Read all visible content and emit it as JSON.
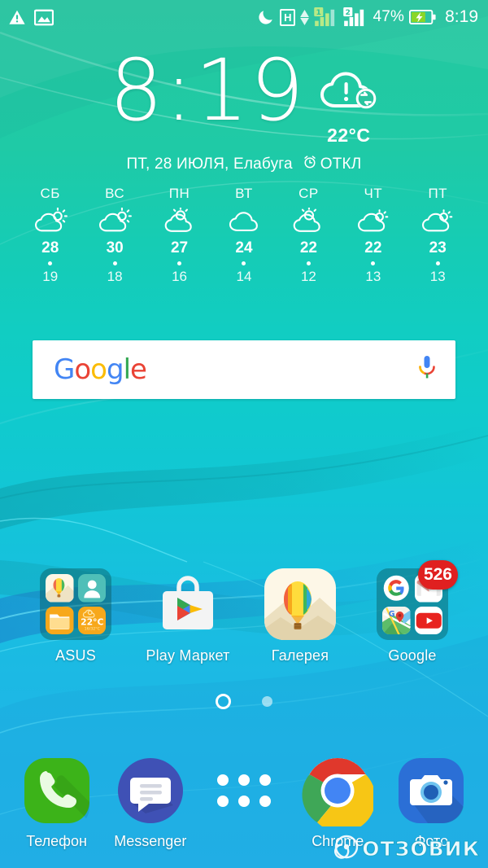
{
  "statusbar": {
    "left_icons": [
      {
        "name": "warning-icon",
        "glyph": "warning"
      },
      {
        "name": "photo-icon",
        "glyph": "image"
      }
    ],
    "dnd_icon": "moon-icon",
    "network_type": "H",
    "sim1_label": "1",
    "sim2_label": "2",
    "battery_percent": "47%",
    "battery_icon": "battery-charging-icon",
    "clock": "8:19"
  },
  "clock_widget": {
    "time": "8:19",
    "weather_icon": "cloud-alert-refresh-icon",
    "temperature": "22°C",
    "date_line": "ПТ, 28 ИЮЛЯ, Елабуга",
    "alarm_icon": "alarm-clock-icon",
    "alarm_status": "ОТКЛ"
  },
  "forecast": {
    "days": [
      {
        "day": "СБ",
        "icon": "partly-cloudy-icon",
        "high": "28",
        "low": "19"
      },
      {
        "day": "ВС",
        "icon": "partly-cloudy-icon",
        "high": "30",
        "low": "18"
      },
      {
        "day": "ПН",
        "icon": "sun-behind-cloud-icon",
        "high": "27",
        "low": "16"
      },
      {
        "day": "ВТ",
        "icon": "cloudy-icon",
        "high": "24",
        "low": "14"
      },
      {
        "day": "СР",
        "icon": "sun-behind-cloud-icon",
        "high": "22",
        "low": "12"
      },
      {
        "day": "ЧТ",
        "icon": "partly-cloudy-icon",
        "high": "22",
        "low": "13"
      },
      {
        "day": "ПТ",
        "icon": "partly-cloudy-icon",
        "high": "23",
        "low": "13"
      }
    ]
  },
  "search": {
    "logo_letters": [
      {
        "char": "G",
        "color": "#4285F4"
      },
      {
        "char": "o",
        "color": "#EA4335"
      },
      {
        "char": "o",
        "color": "#FBBC05"
      },
      {
        "char": "g",
        "color": "#4285F4"
      },
      {
        "char": "l",
        "color": "#34A853"
      },
      {
        "char": "e",
        "color": "#EA4335"
      }
    ],
    "mic_icon": "microphone-icon"
  },
  "apps": {
    "row1": [
      {
        "label": "ASUS",
        "type": "folder",
        "icon": "asus-folder-icon",
        "contents": [
          "gallery-balloon-icon",
          "contacts-icon",
          "file-manager-icon",
          "weather-tile-icon"
        ],
        "weather_tile_temp": "22°C",
        "weather_tile_range": "16/32°C"
      },
      {
        "label": "Play Маркет",
        "type": "app",
        "icon": "play-store-icon"
      },
      {
        "label": "Галерея",
        "type": "app",
        "icon": "gallery-balloon-icon"
      },
      {
        "label": "Google",
        "type": "folder",
        "icon": "google-folder-icon",
        "contents": [
          "google-g-icon",
          "gmail-icon",
          "maps-icon",
          "youtube-icon"
        ],
        "badge": "526"
      }
    ]
  },
  "page_indicator": {
    "pages": 2,
    "current": 1
  },
  "dock": [
    {
      "label": "Телефон",
      "icon": "phone-icon"
    },
    {
      "label": "Messenger",
      "icon": "messenger-icon"
    },
    {
      "label": "",
      "icon": "app-drawer-icon"
    },
    {
      "label": "Chrome",
      "icon": "chrome-icon"
    },
    {
      "label": "Фото",
      "icon": "camera-photos-icon"
    }
  ],
  "watermark": {
    "text": "ОТЗОВИК",
    "icon": "otzovik-logo-icon"
  },
  "colors": {
    "accent_top": "#25c8a0",
    "accent_bottom": "#23b4ea",
    "badge_red": "#e02020",
    "google_blue": "#4285F4",
    "google_red": "#EA4335",
    "google_yellow": "#FBBC05",
    "google_green": "#34A853"
  }
}
